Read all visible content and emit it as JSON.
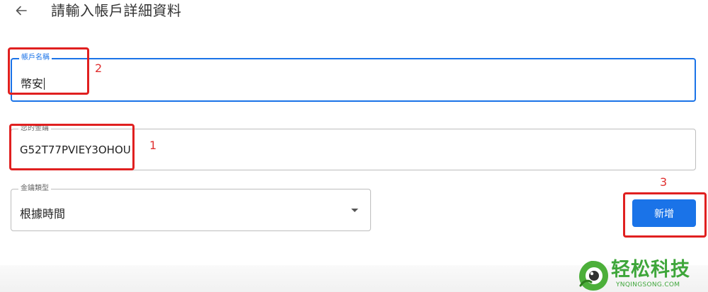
{
  "header": {
    "back_icon": "arrow-back-icon",
    "title": "請輸入帳戶詳細資料"
  },
  "form": {
    "account_name": {
      "label": "帳戶名稱",
      "value": "幣安"
    },
    "key": {
      "label": "您的金鑰",
      "value": "G52T77PVIEY3OHOU"
    },
    "key_type": {
      "label": "金鑰類型",
      "selected": "根據時間",
      "icon": "dropdown-arrow-icon"
    },
    "add_button_label": "新增"
  },
  "annotations": {
    "key_number": "1",
    "account_number": "2",
    "button_number": "3"
  },
  "watermark": {
    "text": "轻松科技",
    "subtext": "YNQINGSONG.COM"
  },
  "colors": {
    "accent": "#1a73e8",
    "annotation": "#e02020",
    "watermark": "#3ea63a"
  }
}
